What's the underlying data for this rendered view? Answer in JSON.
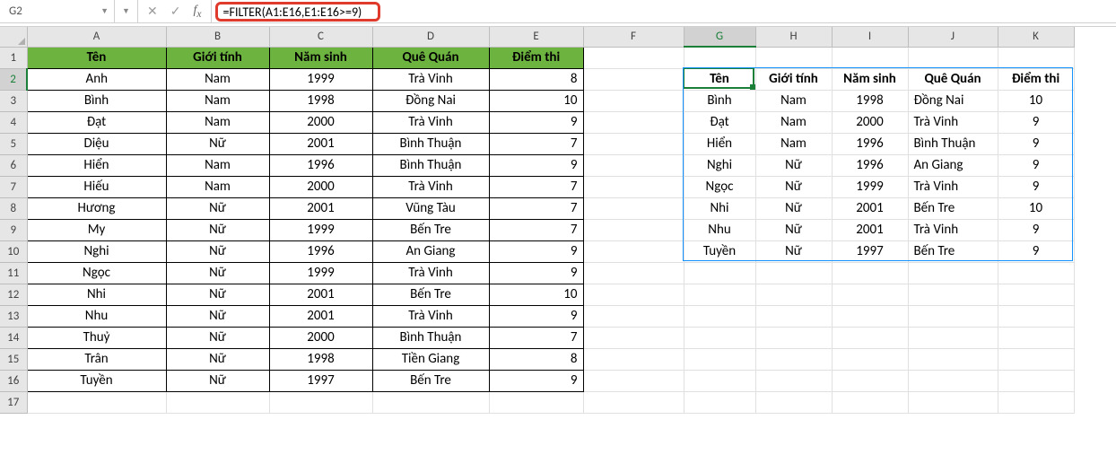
{
  "app": {
    "name_box": "G2",
    "formula": "=FILTER(A1:E16,E1:E16>=9)"
  },
  "columns": [
    "A",
    "B",
    "C",
    "D",
    "E",
    "F",
    "G",
    "H",
    "I",
    "J",
    "K"
  ],
  "row_count": 17,
  "active_cell": {
    "col": "G",
    "row": 2
  },
  "headersA": [
    "Tên",
    "Giới tính",
    "Năm sinh",
    "Quê Quán",
    "Điểm thi"
  ],
  "tableA": [
    {
      "ten": "Anh",
      "gt": "Nam",
      "ns": "1999",
      "qq": "Trà Vinh",
      "dt": "8"
    },
    {
      "ten": "Bình",
      "gt": "Nam",
      "ns": "1998",
      "qq": "Đồng Nai",
      "dt": "10"
    },
    {
      "ten": "Đạt",
      "gt": "Nam",
      "ns": "2000",
      "qq": "Trà Vinh",
      "dt": "9"
    },
    {
      "ten": "Diệu",
      "gt": "Nữ",
      "ns": "2001",
      "qq": "Bình Thuận",
      "dt": "7"
    },
    {
      "ten": "Hiển",
      "gt": "Nam",
      "ns": "1996",
      "qq": "Bình Thuận",
      "dt": "9"
    },
    {
      "ten": "Hiếu",
      "gt": "Nam",
      "ns": "2000",
      "qq": "Trà Vinh",
      "dt": "7"
    },
    {
      "ten": "Hương",
      "gt": "Nữ",
      "ns": "2001",
      "qq": "Vũng Tàu",
      "dt": "7"
    },
    {
      "ten": "My",
      "gt": "Nữ",
      "ns": "1999",
      "qq": "Bến Tre",
      "dt": "7"
    },
    {
      "ten": "Nghi",
      "gt": "Nữ",
      "ns": "1996",
      "qq": "An Giang",
      "dt": "9"
    },
    {
      "ten": "Ngọc",
      "gt": "Nữ",
      "ns": "1999",
      "qq": "Trà Vinh",
      "dt": "9"
    },
    {
      "ten": "Nhi",
      "gt": "Nữ",
      "ns": "2001",
      "qq": "Bến Tre",
      "dt": "10"
    },
    {
      "ten": "Nhu",
      "gt": "Nữ",
      "ns": "2001",
      "qq": "Trà Vinh",
      "dt": "9"
    },
    {
      "ten": "Thuỷ",
      "gt": "Nữ",
      "ns": "2000",
      "qq": "Bình Thuận",
      "dt": "7"
    },
    {
      "ten": "Trân",
      "gt": "Nữ",
      "ns": "1998",
      "qq": "Tiền Giang",
      "dt": "8"
    },
    {
      "ten": "Tuyền",
      "gt": "Nữ",
      "ns": "1997",
      "qq": "Bến Tre",
      "dt": "9"
    }
  ],
  "headersB": [
    "Tên",
    "Giới tính",
    "Năm sinh",
    "Quê Quán",
    "Điểm thi"
  ],
  "tableB": [
    {
      "ten": "Bình",
      "gt": "Nam",
      "ns": "1998",
      "qq": "Đồng Nai",
      "dt": "10"
    },
    {
      "ten": "Đạt",
      "gt": "Nam",
      "ns": "2000",
      "qq": "Trà Vinh",
      "dt": "9"
    },
    {
      "ten": "Hiển",
      "gt": "Nam",
      "ns": "1996",
      "qq": "Bình Thuận",
      "dt": "9"
    },
    {
      "ten": "Nghi",
      "gt": "Nữ",
      "ns": "1996",
      "qq": "An Giang",
      "dt": "9"
    },
    {
      "ten": "Ngọc",
      "gt": "Nữ",
      "ns": "1999",
      "qq": "Trà Vinh",
      "dt": "9"
    },
    {
      "ten": "Nhi",
      "gt": "Nữ",
      "ns": "2001",
      "qq": "Bến Tre",
      "dt": "10"
    },
    {
      "ten": "Nhu",
      "gt": "Nữ",
      "ns": "2001",
      "qq": "Trà Vinh",
      "dt": "9"
    },
    {
      "ten": "Tuyền",
      "gt": "Nữ",
      "ns": "1997",
      "qq": "Bến Tre",
      "dt": "9"
    }
  ]
}
